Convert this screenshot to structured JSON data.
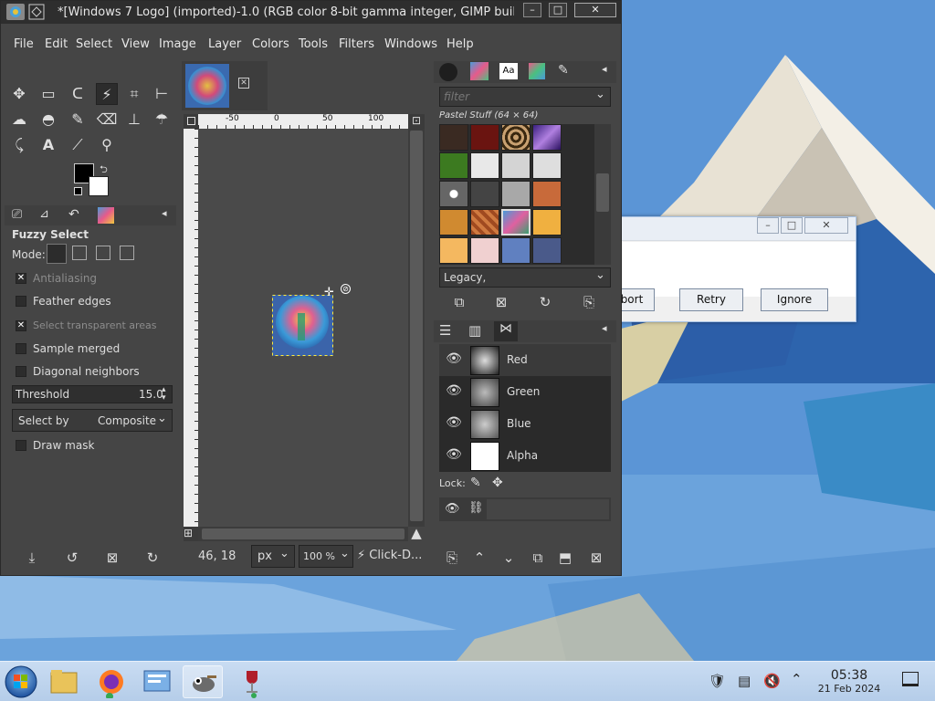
{
  "window": {
    "title": "*[Windows 7 Logo] (imported)-1.0 (RGB color 8-bit gamma integer, GIMP built-in ..."
  },
  "menubar": [
    "File",
    "Edit",
    "Select",
    "View",
    "Image",
    "Layer",
    "Colors",
    "Tools",
    "Filters",
    "Windows",
    "Help"
  ],
  "tool_options": {
    "title": "Fuzzy Select",
    "mode_label": "Mode:",
    "antialiasing": "Antialiasing",
    "feather_edges": "Feather edges",
    "select_transparent": "Select transparent areas",
    "sample_merged": "Sample merged",
    "diagonal_neighbors": "Diagonal neighbors",
    "threshold_label": "Threshold",
    "threshold_value": "15.0",
    "select_by_label": "Select by",
    "select_by_value": "Composite",
    "draw_mask": "Draw mask"
  },
  "ruler": {
    "top_ticks": [
      "-50",
      "0",
      "50",
      "100"
    ],
    "left_ticks": [
      "0",
      "50",
      "100",
      "150",
      "200",
      "250",
      "300",
      "350",
      "400"
    ]
  },
  "statusbar": {
    "coords": "46, 18",
    "unit": "px",
    "zoom": "100 %",
    "message": "Click-D..."
  },
  "patterns": {
    "filter_placeholder": "filter",
    "set_name": "Pastel Stuff (64 × 64)",
    "tag": "Legacy,"
  },
  "layers": [
    {
      "name": "Red"
    },
    {
      "name": "Green"
    },
    {
      "name": "Blue"
    },
    {
      "name": "Alpha"
    }
  ],
  "lock_label": "Lock:",
  "dialog": {
    "abort_partial": "bort",
    "retry": "Retry",
    "ignore": "Ignore"
  },
  "taskbar": {
    "time": "05:38",
    "date": "21 Feb 2024"
  },
  "colors": {
    "gimp_bg": "#454545",
    "accent_blue": "#3b78c4"
  }
}
